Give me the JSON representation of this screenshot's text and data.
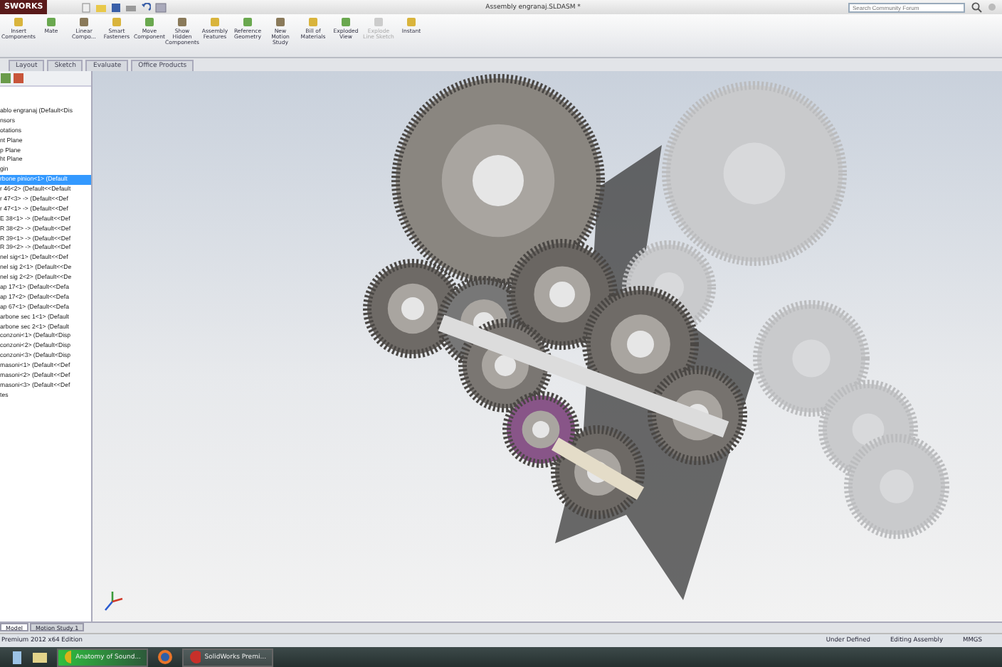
{
  "titlebar": {
    "logo": "SWORKS",
    "title": "Assembly engranaj.SLDASM *",
    "search": {
      "placeholder": "Search Community Forum"
    }
  },
  "ribbon": [
    {
      "label": "Insert Components",
      "disabled": false
    },
    {
      "label": "Mate",
      "disabled": false
    },
    {
      "label": "Linear Compo...",
      "disabled": false
    },
    {
      "label": "Smart Fasteners",
      "disabled": false
    },
    {
      "label": "Move Component",
      "disabled": false
    },
    {
      "label": "Show Hidden Components",
      "disabled": false
    },
    {
      "label": "Assembly Features",
      "disabled": false
    },
    {
      "label": "Reference Geometry",
      "disabled": false
    },
    {
      "label": "New Motion Study",
      "disabled": false
    },
    {
      "label": "Bill of Materials",
      "disabled": false
    },
    {
      "label": "Exploded View",
      "disabled": false
    },
    {
      "label": "Explode Line Sketch",
      "disabled": true
    },
    {
      "label": "Instant",
      "disabled": false
    }
  ],
  "tabs": [
    {
      "label": "Layout",
      "selected": false
    },
    {
      "label": "Sketch",
      "selected": false
    },
    {
      "label": "Evaluate",
      "selected": false
    },
    {
      "label": "Office Products",
      "selected": false
    }
  ],
  "tree": [
    {
      "label": "ablo engranaj  (Default<Dis",
      "selected": false
    },
    {
      "label": "nsors",
      "selected": false
    },
    {
      "label": "otations",
      "selected": false
    },
    {
      "label": "nt Plane",
      "selected": false
    },
    {
      "label": "p Plane",
      "selected": false
    },
    {
      "label": "ht Plane",
      "selected": false
    },
    {
      "label": "gin",
      "selected": false
    },
    {
      "label": "rbone pinion<1> (Default",
      "selected": true
    },
    {
      "label": "r 46<2> (Default<<Default",
      "selected": false
    },
    {
      "label": "r 47<3> -> (Default<<Def",
      "selected": false
    },
    {
      "label": "r 47<1> -> (Default<<Def",
      "selected": false
    },
    {
      "label": "E 38<1> -> (Default<<Def",
      "selected": false
    },
    {
      "label": "R 38<2> -> (Default<<Def",
      "selected": false
    },
    {
      "label": "R 39<1> -> (Default<<Def",
      "selected": false
    },
    {
      "label": "R 39<2> -> (Default<<Def",
      "selected": false
    },
    {
      "label": "nel sig<1> (Default<<Def",
      "selected": false
    },
    {
      "label": "nel sig 2<1> (Default<<De",
      "selected": false
    },
    {
      "label": "nel sig 2<2> (Default<<De",
      "selected": false
    },
    {
      "label": "ap 17<1> (Default<<Defa",
      "selected": false
    },
    {
      "label": "ap 17<2> (Default<<Defa",
      "selected": false
    },
    {
      "label": "ap 67<1> (Default<<Defa",
      "selected": false
    },
    {
      "label": "arbone sec 1<1> (Default",
      "selected": false
    },
    {
      "label": "arbone sec 2<1> (Default",
      "selected": false
    },
    {
      "label": "conzoni<1> (Default<Disp",
      "selected": false
    },
    {
      "label": "conzoni<2> (Default<Disp",
      "selected": false
    },
    {
      "label": "conzoni<3> (Default<Disp",
      "selected": false
    },
    {
      "label": "masoni<1> (Default<<Def",
      "selected": false
    },
    {
      "label": "masoni<2> (Default<<Def",
      "selected": false
    },
    {
      "label": "masoni<3> (Default<<Def",
      "selected": false
    },
    {
      "label": "tes",
      "selected": false
    }
  ],
  "bottom_tabs": [
    {
      "label": "Model",
      "selected": true
    },
    {
      "label": "Motion Study 1",
      "selected": false
    }
  ],
  "status_bar": {
    "edition": "Premium 2012 x64 Edition",
    "items": [
      "Under Defined",
      "Editing Assembly",
      "MMGS"
    ]
  },
  "taskbar": [
    {
      "label": "Anatomy of Sound...",
      "kind": "active"
    },
    {
      "label": "SolidWorks Premi...",
      "kind": "window"
    }
  ]
}
